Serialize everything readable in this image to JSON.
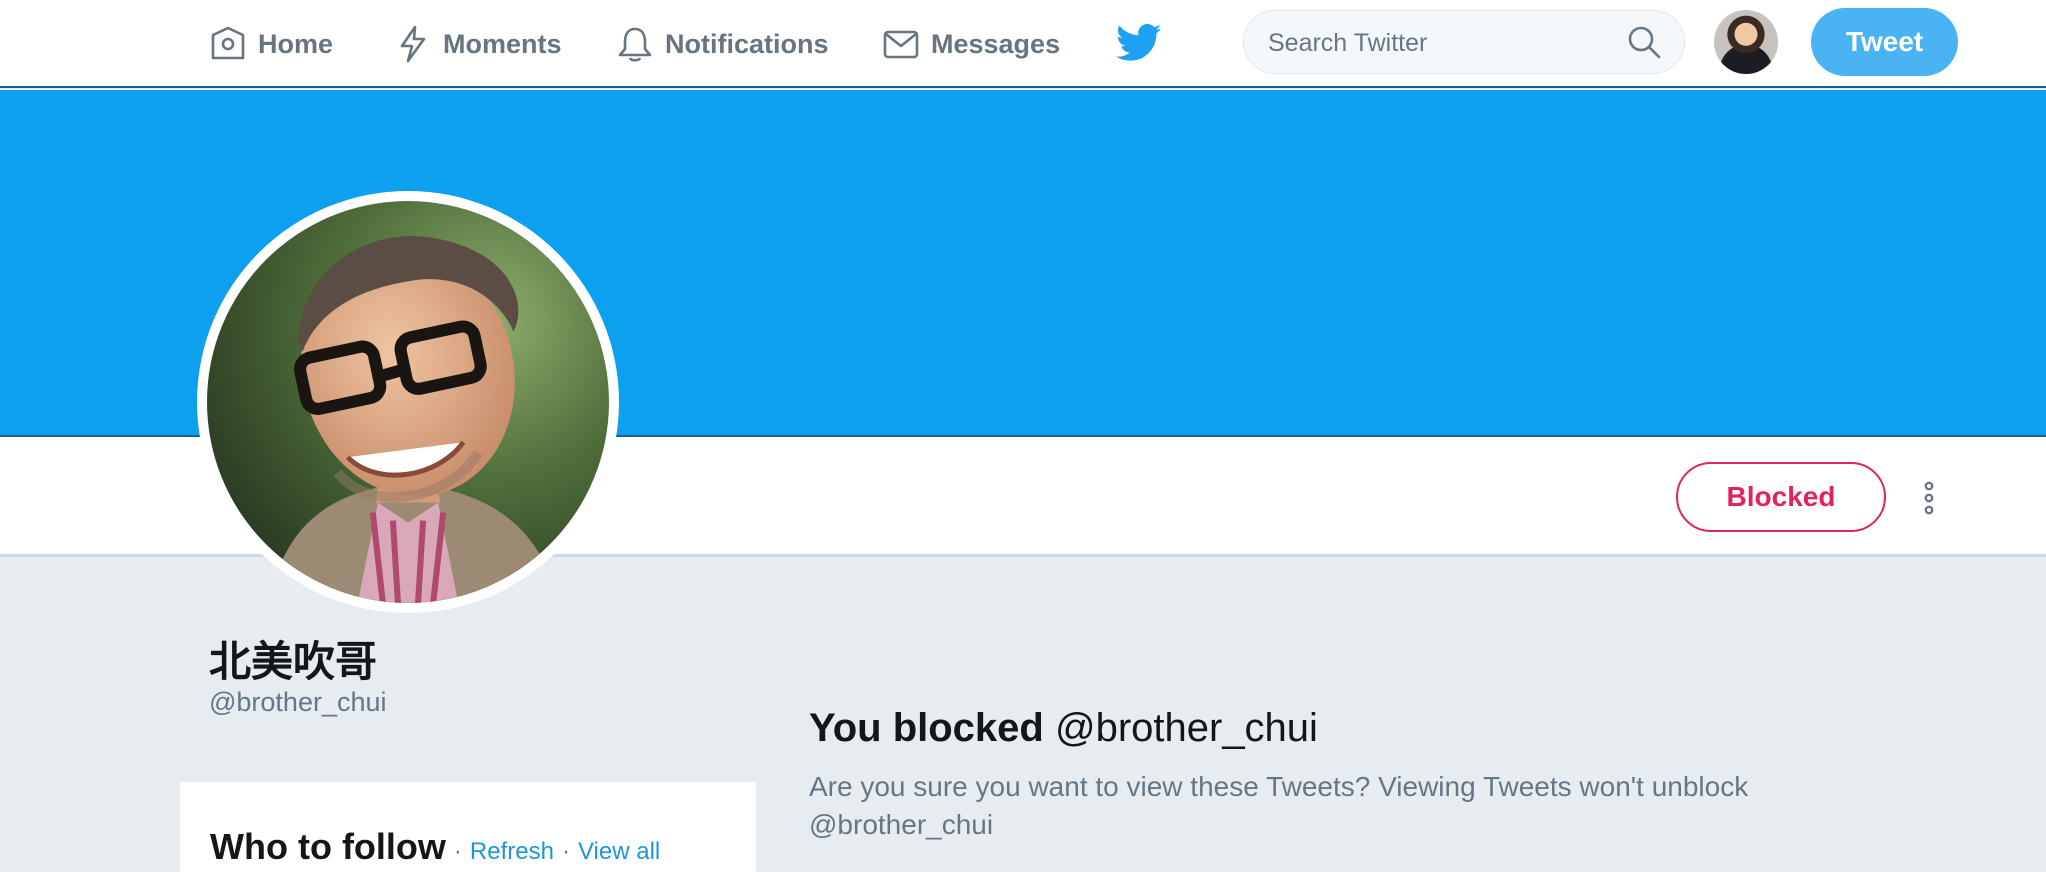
{
  "nav": {
    "home": "Home",
    "moments": "Moments",
    "notifications": "Notifications",
    "messages": "Messages"
  },
  "search": {
    "placeholder": "Search Twitter"
  },
  "tweet_button": "Tweet",
  "profile": {
    "display_name": "北美吹哥",
    "screen_name": "@brother_chui"
  },
  "actions": {
    "blocked_label": "Blocked"
  },
  "who_to_follow": {
    "title": "Who to follow",
    "separator": "·",
    "refresh": "Refresh",
    "view_all": "View all"
  },
  "blocked_notice": {
    "title_prefix": "You blocked",
    "title_handle": "@brother_chui",
    "description": "Are you sure you want to view these Tweets? Viewing Tweets won't unblock @brother_chui"
  },
  "colors": {
    "banner": "#0ca0ee",
    "brand": "#1da1f2",
    "blocked": "#e0245e",
    "tweet_button": "#4ab3f4"
  },
  "icons": [
    "home-icon",
    "moments-icon",
    "notifications-icon",
    "messages-icon",
    "twitter-logo-icon",
    "search-icon",
    "more-icon"
  ]
}
